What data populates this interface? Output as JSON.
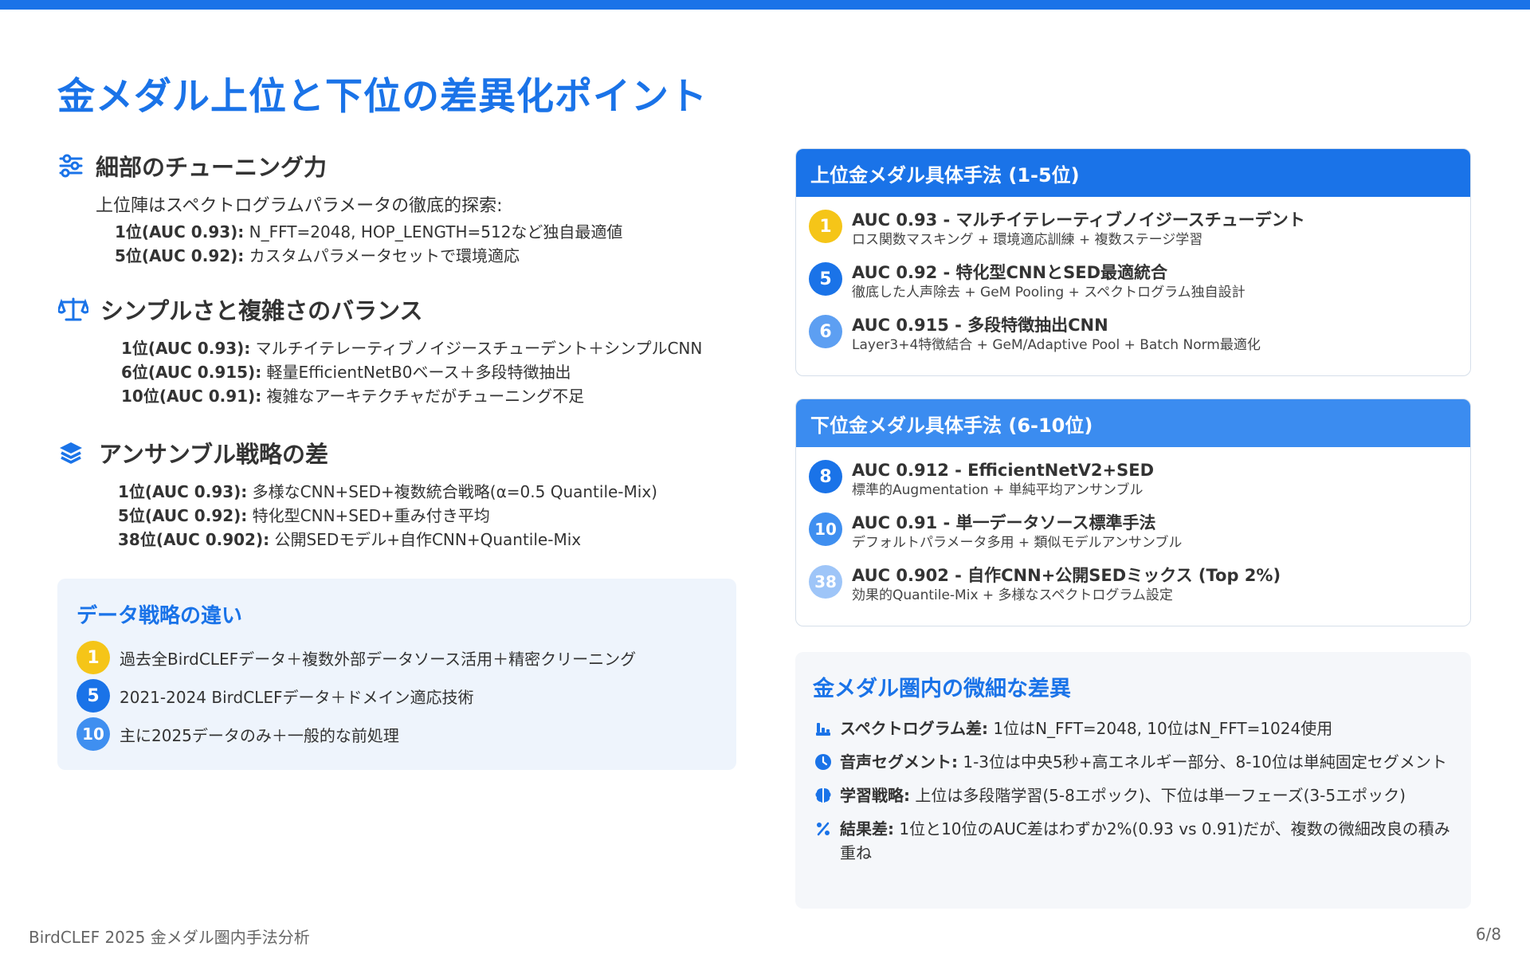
{
  "title": "金メダル上位と下位の差異化ポイント",
  "colors": {
    "accent": "#1a73e8",
    "gold": "#f5c518",
    "box_bg": "#eef4fc"
  },
  "sections": [
    {
      "icon": "sliders-icon",
      "title": "細部のチューニング力",
      "lead": "上位陣はスペクトログラムパラメータの徹底的探索:",
      "rows": [
        {
          "rank": "1位(AUC 0.93):",
          "text": " N_FFT=2048, HOP_LENGTH=512など独自最適値"
        },
        {
          "rank": "5位(AUC 0.92):",
          "text": " カスタムパラメータセットで環境適応"
        }
      ]
    },
    {
      "icon": "balance-scale-icon",
      "title": "シンプルさと複雑さのバランス",
      "rows": [
        {
          "rank": "1位(AUC 0.93):",
          "text": " マルチイテレーティブノイジースチューデント＋シンプルCNN"
        },
        {
          "rank": "6位(AUC 0.915):",
          "text": " 軽量EfficientNetB0ベース＋多段特徴抽出"
        },
        {
          "rank": "10位(AUC 0.91):",
          "text": " 複雑なアーキテクチャだがチューニング不足"
        }
      ]
    },
    {
      "icon": "layers-icon",
      "title": "アンサンブル戦略の差",
      "rows": [
        {
          "rank": "1位(AUC 0.93):",
          "text": " 多様なCNN+SED+複数統合戦略(α=0.5 Quantile-Mix)"
        },
        {
          "rank": "5位(AUC 0.92):",
          "text": " 特化型CNN+SED+重み付き平均"
        },
        {
          "rank": "38位(AUC 0.902):",
          "text": " 公開SEDモデル+自作CNN+Quantile-Mix"
        }
      ]
    }
  ],
  "data_strategy": {
    "title": "データ戦略の違い",
    "items": [
      {
        "badge": "1",
        "text": "過去全BirdCLEFデータ＋複数外部データソース活用＋精密クリーニング"
      },
      {
        "badge": "5",
        "text": "2021-2024 BirdCLEFデータ＋ドメイン適応技術"
      },
      {
        "badge": "10",
        "text": "主に2025データのみ＋一般的な前処理"
      }
    ]
  },
  "top_card": {
    "title": "上位金メダル具体手法 (1-5位)",
    "items": [
      {
        "badge": "1",
        "title": "AUC 0.93 - マルチイテレーティブノイジースチューデント",
        "desc": "ロス関数マスキング + 環境適応訓練 + 複数ステージ学習"
      },
      {
        "badge": "5",
        "title": "AUC 0.92 - 特化型CNNとSED最適統合",
        "desc": "徹底した人声除去 + GeM Pooling + スペクトログラム独自設計"
      },
      {
        "badge": "6",
        "title": "AUC 0.915 - 多段特徴抽出CNN",
        "desc": "Layer3+4特徴結合 + GeM/Adaptive Pool + Batch Norm最適化"
      }
    ]
  },
  "bottom_card": {
    "title": "下位金メダル具体手法 (6-10位)",
    "items": [
      {
        "badge": "8",
        "title": "AUC 0.912 - EfficientNetV2+SED",
        "desc": "標準的Augmentation + 単純平均アンサンブル"
      },
      {
        "badge": "10",
        "title": "AUC 0.91 - 単一データソース標準手法",
        "desc": "デフォルトパラメータ多用 + 類似モデルアンサンブル"
      },
      {
        "badge": "38",
        "title": "AUC 0.902 - 自作CNN+公開SEDミックス (Top 2%)",
        "desc": "効果的Quantile-Mix + 多様なスペクトログラム設定"
      }
    ]
  },
  "subtle_diff": {
    "title": "金メダル圏内の微細な差異",
    "items": [
      {
        "icon": "waveform-icon",
        "label": "スペクトログラム差:",
        "text": " 1位はN_FFT=2048, 10位はN_FFT=1024使用"
      },
      {
        "icon": "clock-icon",
        "label": "音声セグメント:",
        "text": " 1-3位は中央5秒+高エネルギー部分、8-10位は単純固定セグメント"
      },
      {
        "icon": "brain-icon",
        "label": "学習戦略:",
        "text": " 上位は多段階学習(5-8エポック)、下位は単一フェーズ(3-5エポック)"
      },
      {
        "icon": "percent-icon",
        "label": "結果差:",
        "text": " 1位と10位のAUC差はわずか2%(0.93 vs 0.91)だが、複数の微細改良の積み重ね"
      }
    ]
  },
  "footer": {
    "left": "BirdCLEF 2025 金メダル圏内手法分析",
    "page": "6/8"
  }
}
